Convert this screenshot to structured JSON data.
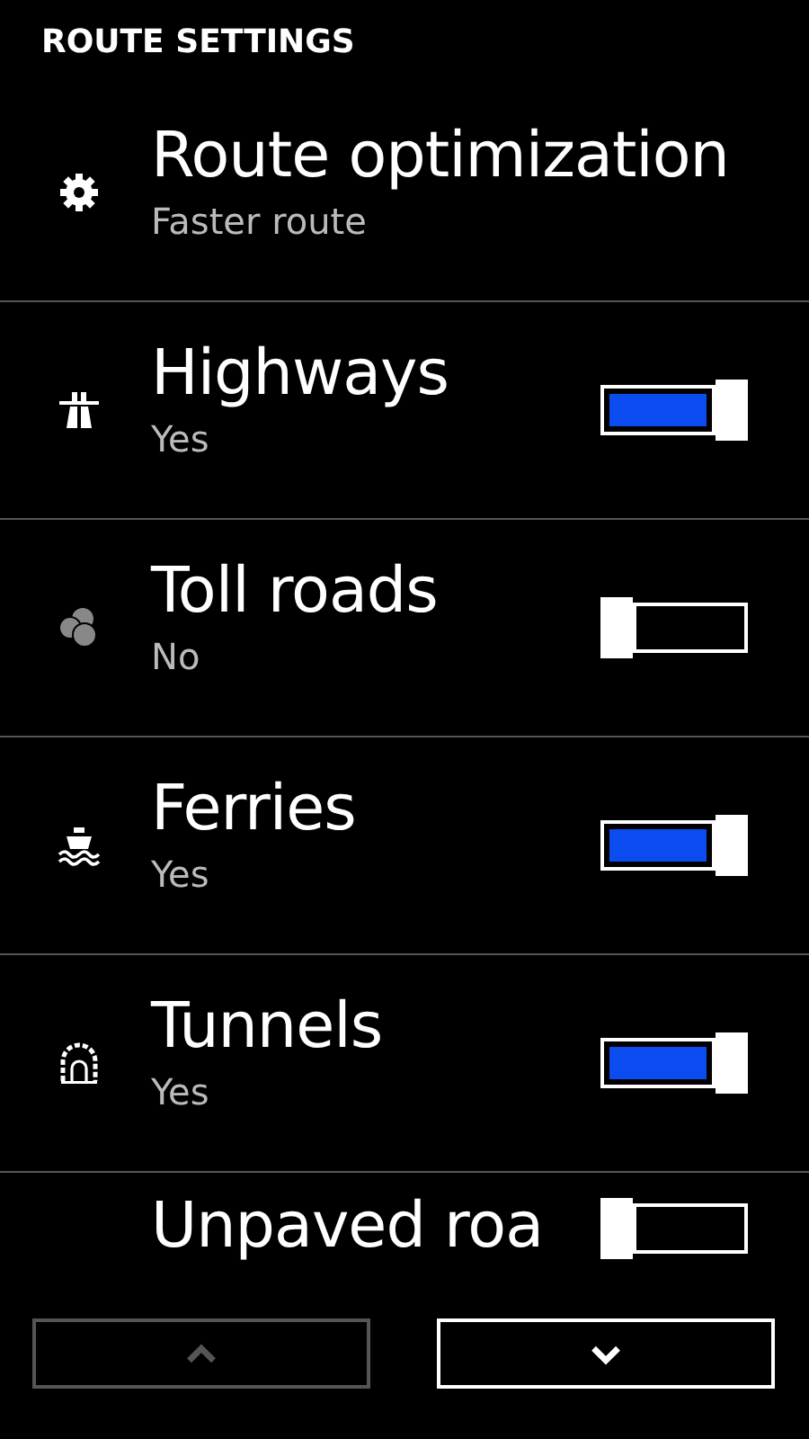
{
  "header": {
    "title": "ROUTE SETTINGS"
  },
  "settings": [
    {
      "kind": "choice",
      "label": "Route optimization",
      "value": "Faster route"
    },
    {
      "kind": "toggle",
      "label": "Highways",
      "value": "Yes",
      "on": true
    },
    {
      "kind": "toggle",
      "label": "Toll roads",
      "value": "No",
      "on": false
    },
    {
      "kind": "toggle",
      "label": "Ferries",
      "value": "Yes",
      "on": true
    },
    {
      "kind": "toggle",
      "label": "Tunnels",
      "value": "Yes",
      "on": true
    },
    {
      "kind": "toggle",
      "label": "Unpaved roa",
      "on": false
    }
  ],
  "buttons": [
    {
      "kind": "up",
      "disabled": true
    },
    {
      "kind": "down",
      "disabled": false
    }
  ]
}
